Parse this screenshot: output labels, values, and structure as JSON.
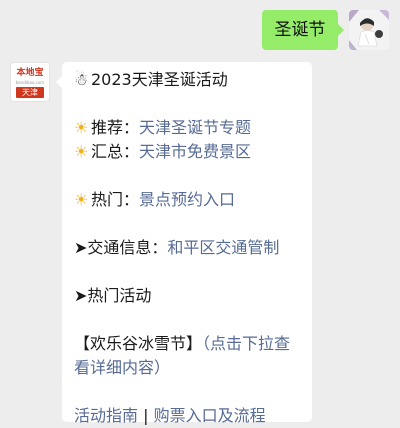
{
  "sent": {
    "text": "圣诞节"
  },
  "bot": {
    "logo_top": "本地宝",
    "logo_sub": "bendibao.com",
    "logo_tag": "天津"
  },
  "reply": {
    "title_icon": "☃",
    "title": "2023天津圣诞活动",
    "sun_icon": "☀",
    "recommend_label": "推荐：",
    "recommend_link": "天津圣诞节专题",
    "summary_label": "汇总：",
    "summary_link": "天津市免费景区",
    "hot_label": "热门：",
    "hot_link": "景点预约入口",
    "arrow": "➤",
    "traffic_label": "交通信息：",
    "traffic_link": "和平区交通管制",
    "hot_events": "热门活动",
    "festival_name": "【欢乐谷冰雪节】",
    "festival_link": "（点击下拉查看详细内容）",
    "guide_link": "活动指南",
    "sep": "|",
    "ticket_link": "购票入口及流程"
  },
  "colors": {
    "sent_bubble": "#95ec69",
    "link": "#576b95",
    "background": "#ededed",
    "brand_red": "#d0371f"
  }
}
